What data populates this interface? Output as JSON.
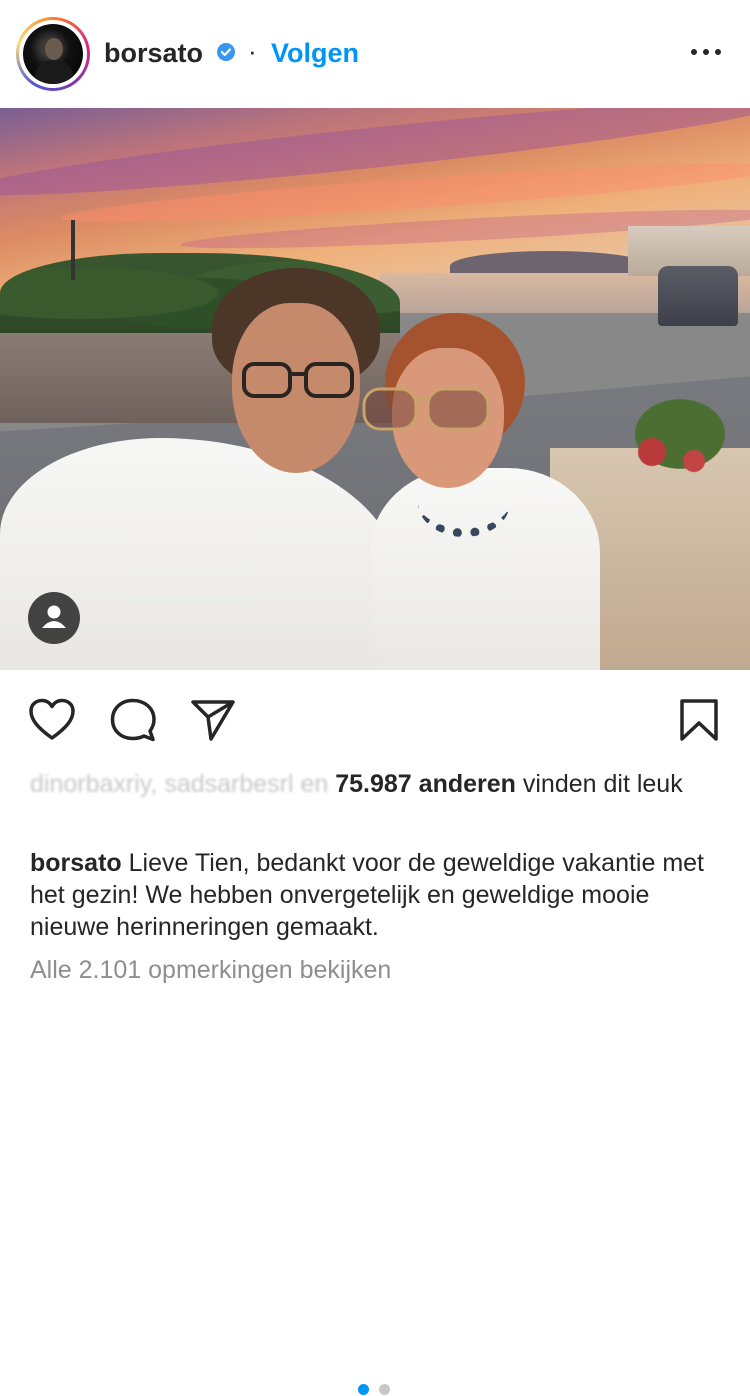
{
  "header": {
    "username": "borsato",
    "separator": "·",
    "follow_label": "Volgen",
    "verified_color": "#3897f0",
    "follow_color": "#0095f6"
  },
  "post": {
    "pager": {
      "total": 2,
      "active_index": 1,
      "active_color": "#0095f6",
      "inactive_color": "#c7c7c7"
    },
    "likes": {
      "faded_prefix": "dinorbaxriy, sadsarbesrl en",
      "count": "75.987 anderen",
      "suffix": "vinden dit leuk"
    },
    "caption": {
      "username": "borsato",
      "text": "Lieve Tien, bedankt voor de geweldige vakantie met het gezin! We hebben onvergetelijk en geweldige mooie nieuwe herinneringen gemaakt."
    },
    "comments_link": "Alle 2.101 opmerkingen bekijken"
  },
  "icons": {
    "more": "more-options-icon",
    "like": "heart-icon",
    "comment": "comment-icon",
    "share": "share-icon",
    "save": "bookmark-icon",
    "tag": "user-tag-icon",
    "verified": "verified-badge-icon"
  }
}
